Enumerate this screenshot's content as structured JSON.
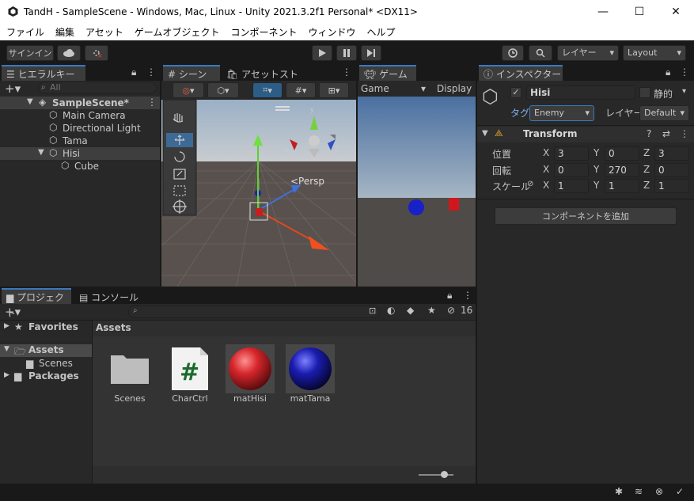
{
  "window": {
    "title": "TandH - SampleScene - Windows, Mac, Linux - Unity 2021.3.2f1 Personal* <DX11>",
    "minimize": "—",
    "maximize": "☐",
    "close": "✕"
  },
  "menu": [
    "ファイル",
    "編集",
    "アセット",
    "ゲームオブジェクト",
    "コンポーネント",
    "ウィンドウ",
    "ヘルプ"
  ],
  "toolbar": {
    "signin": "サインイン",
    "layers": "レイヤー",
    "layout": "Layout"
  },
  "hierarchy": {
    "tab": "ヒエラルキー",
    "search_placeholder": "All",
    "scene": "SampleScene*",
    "items": [
      {
        "label": "Main Camera"
      },
      {
        "label": "Directional Light"
      },
      {
        "label": "Tama"
      },
      {
        "label": "Hisi"
      },
      {
        "label": "Cube"
      }
    ]
  },
  "scene": {
    "tab": "シーン",
    "tab2": "アセットストア",
    "persp": "<Persp",
    "gizmo": {
      "y": "y",
      "x": "x",
      "z": "z"
    }
  },
  "game": {
    "tab": "ゲーム",
    "mode": "Game",
    "display": "Display"
  },
  "inspector": {
    "tab": "インスペクター",
    "name": "Hisi",
    "static": "静的",
    "tag_label": "タグ",
    "tag": "Enemy",
    "layer_label": "レイヤー",
    "layer": "Default",
    "transform": "Transform",
    "position": {
      "label": "位置",
      "x": "3",
      "y": "0",
      "z": "3"
    },
    "rotation": {
      "label": "回転",
      "x": "0",
      "y": "270",
      "z": "0"
    },
    "scale": {
      "label": "スケール",
      "x": "1",
      "y": "1",
      "z": "1"
    },
    "add_component": "コンポーネントを追加",
    "ax": "X",
    "ay": "Y",
    "az": "Z"
  },
  "project": {
    "tab": "プロジェクト",
    "tab2": "コンソール",
    "hidden_count": "16",
    "favorites": "Favorites",
    "assets": "Assets",
    "scenes": "Scenes",
    "packages": "Packages",
    "breadcrumb": "Assets",
    "assets_items": [
      {
        "label": "Scenes"
      },
      {
        "label": "CharCtrl"
      },
      {
        "label": "matHisi"
      },
      {
        "label": "matTama"
      }
    ]
  },
  "colors": {
    "accent": "#3a79bb",
    "selection": "#2c5d87",
    "red_mat": "#d6262c",
    "blue_mat": "#1a1cb0"
  }
}
